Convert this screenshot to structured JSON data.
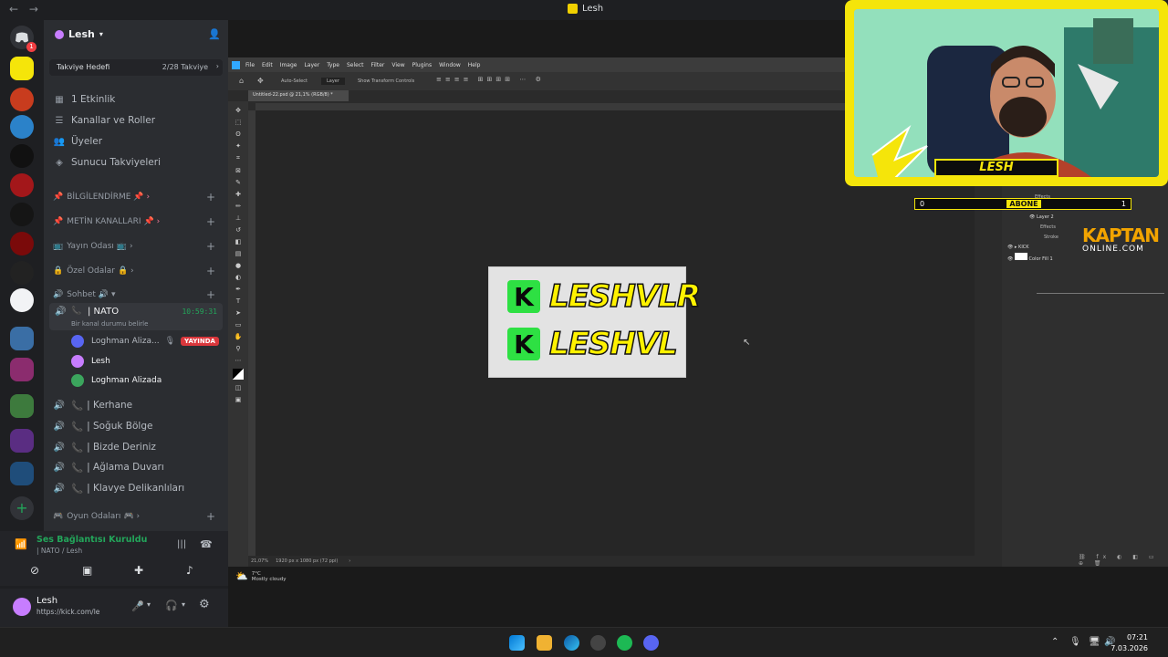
{
  "window": {
    "title": "Lesh",
    "back": "←",
    "forward": "→"
  },
  "server": {
    "name": "Lesh",
    "boost_label": "Takviye Hedefi",
    "boost_progress": "2/28 Takviye",
    "menu": [
      "1 Etkinlik",
      "Kanallar ve Roller",
      "Üyeler",
      "Sunucu Takviyeleri"
    ],
    "categories": {
      "bilgi": "BİLGİLENDİRME",
      "metin": "METİN KANALLARI",
      "yayin": "Yayın Odası",
      "ozel": "Özel Odalar",
      "sohbet": "Sohbet",
      "oyun": "Oyun Odaları"
    },
    "active_voice": {
      "name": "| NATO",
      "timer": "10:59:31",
      "status": "Bir kanal durumu belirle",
      "users": [
        {
          "name": "Loghman Aliza...",
          "live": "YAYINDA"
        },
        {
          "name": "Lesh"
        },
        {
          "name": "Loghman Alizada"
        }
      ]
    },
    "voice_channels": [
      "| Kerhane",
      "| Soğuk Bölge",
      "| Bizde Deriniz",
      "| Ağlama Duvarı",
      "| Klavye Delikanlıları"
    ]
  },
  "voice_panel": {
    "status": "Ses Bağlantısı Kuruldu",
    "channel": "| NATO / Lesh"
  },
  "user_panel": {
    "name": "Lesh",
    "status": "https://kick.com/le"
  },
  "photoshop": {
    "menu": [
      "File",
      "Edit",
      "Image",
      "Layer",
      "Type",
      "Select",
      "Filter",
      "View",
      "Plugins",
      "Window",
      "Help"
    ],
    "options": {
      "auto_select": "Auto-Select",
      "layer": "Layer",
      "transform": "Show Transform Controls"
    },
    "doc_tab": "Untitled-22.psd @ 21,1% (RGB/8) *",
    "zoom": "21,07%",
    "doc_size": "1920 px x 1080 px (72 ppi)",
    "layers": [
      "Effects",
      "Stroke",
      "Layer 2",
      "Effects",
      "Stroke",
      "KICK",
      "Color Fill 1"
    ],
    "artwork": {
      "line1": "LESHVLR",
      "line2": "LESHVL",
      "logo": "K"
    }
  },
  "weather": {
    "temp": "7°C",
    "desc": "Mostly cloudy"
  },
  "stream_overlay": {
    "name": "LESH",
    "sub_left": "0",
    "sub_label": "ABONE",
    "sub_right": "1",
    "sponsor_top": "KAPTAN",
    "sponsor_bottom": "ONLINE.COM"
  },
  "taskbar": {
    "time": "07:21",
    "date": "7.03.2026"
  },
  "colors": {
    "accent_green": "#23a55a",
    "brand_yellow": "#f5e50a",
    "kick_green": "#2ee043",
    "live_red": "#da373c"
  }
}
